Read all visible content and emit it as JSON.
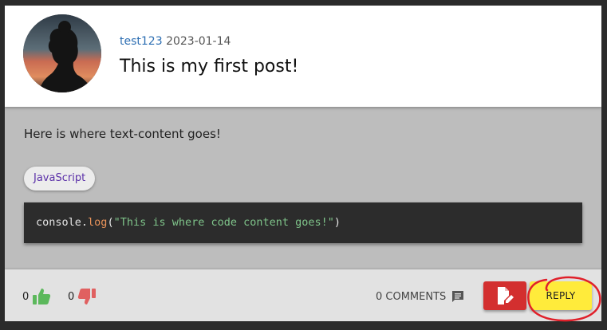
{
  "post": {
    "username": "test123",
    "date": "2023-01-14",
    "title": "This is my first post!",
    "text_content": "Here is where text-content goes!",
    "tag": "JavaScript",
    "code": {
      "object": "console",
      "dot": ".",
      "method": "log",
      "open_paren": "(",
      "string": "\"This is where code content goes!\"",
      "close_paren": ")"
    }
  },
  "footer": {
    "likes": "0",
    "dislikes": "0",
    "comments_label": "0 COMMENTS",
    "reply_label": "REPLY"
  },
  "icons": {
    "like": "thumb-up-icon",
    "dislike": "thumb-down-icon",
    "comment": "comment-icon",
    "edit": "edit-document-icon"
  },
  "colors": {
    "username": "#2e6fb3",
    "like": "#5cb85c",
    "dislike": "#e06060",
    "edit_button": "#d32f2f",
    "reply_button": "#ffeb3b",
    "annotation": "#e0202a",
    "tag_text": "#5a2fa8"
  }
}
